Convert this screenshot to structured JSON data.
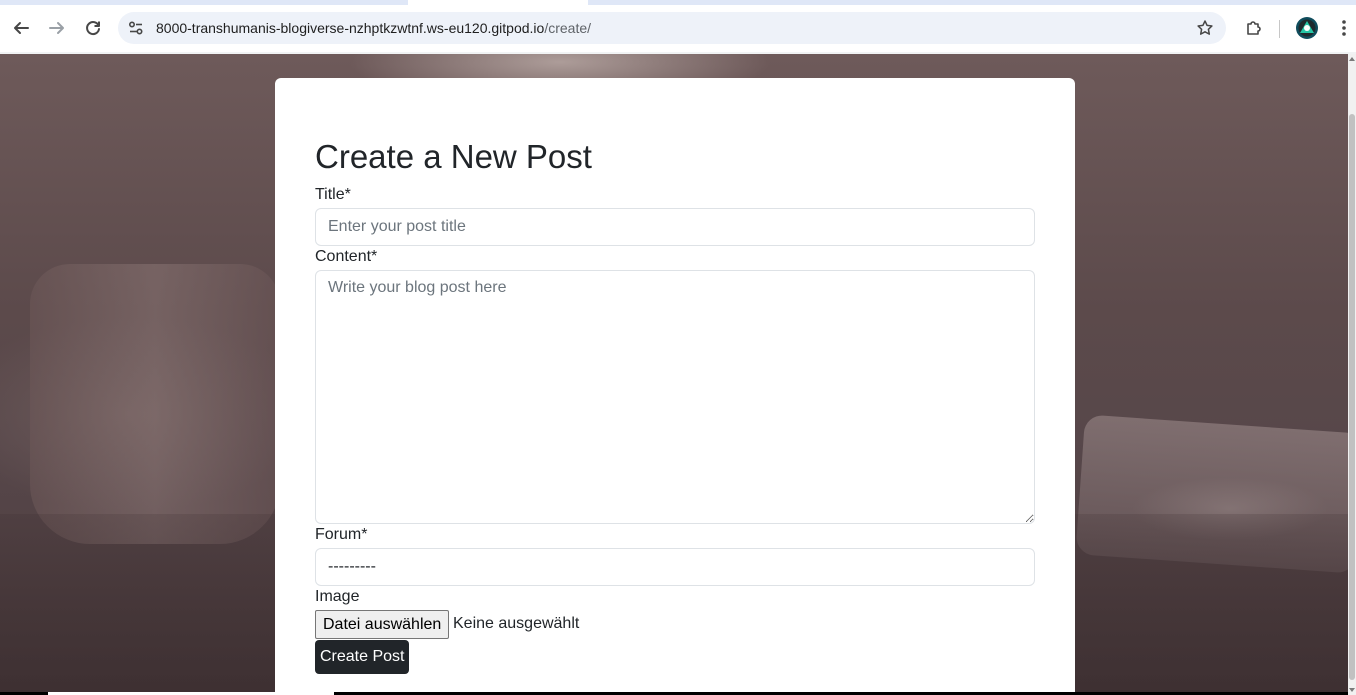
{
  "browser": {
    "url_host": "8000-transhumanis-blogiverse-nzhptkzwtnf.ws-eu120.gitpod.io",
    "url_path": "/create/",
    "icons": {
      "back": "arrow-left-icon",
      "forward": "arrow-right-icon",
      "reload": "reload-icon",
      "site_info": "tune-icon",
      "bookmark": "star-icon",
      "extensions": "puzzle-icon",
      "profile": "avatar",
      "menu": "kebab-menu-icon"
    }
  },
  "form": {
    "heading": "Create a New Post",
    "title_label": "Title*",
    "title_placeholder": "Enter your post title",
    "content_label": "Content*",
    "content_placeholder": "Write your blog post here",
    "forum_label": "Forum*",
    "forum_selected": "---------",
    "image_label": "Image",
    "file_button": "Datei auswählen",
    "file_status": "Keine ausgewählt",
    "submit_label": "Create Post"
  },
  "colors": {
    "submit_bg": "#212529",
    "card_bg": "#ffffff",
    "omnibox_bg": "#eef2f9"
  }
}
